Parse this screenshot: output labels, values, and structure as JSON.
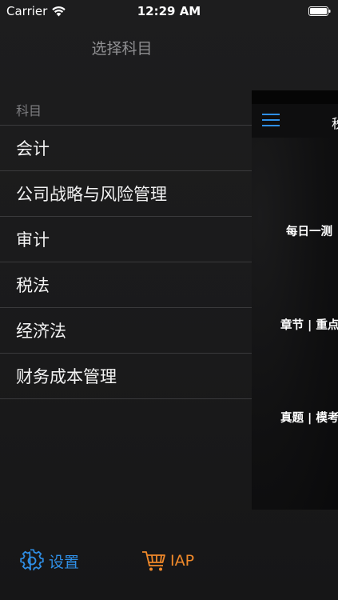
{
  "status_bar": {
    "carrier": "Carrier",
    "time": "12:29 AM"
  },
  "menu": {
    "title": "选择科目",
    "section_header": "科目",
    "subjects": [
      "会计",
      "公司战略与风险管理",
      "审计",
      "税法",
      "经济法",
      "财务成本管理"
    ]
  },
  "bottom": {
    "settings_label": "设置",
    "iap_label": "IAP"
  },
  "main_panel": {
    "nav_title": "税",
    "daily_test": "每日一测",
    "chapter_key": "章节 | 重点",
    "exam_mock": "真题 | 模考"
  },
  "colors": {
    "background": "#1b1b1c",
    "accent_blue": "#2f8fe6",
    "accent_orange": "#f0892a",
    "separator": "#3a3a3c"
  },
  "icons": {
    "wifi": "wifi-icon",
    "battery": "battery-icon",
    "settings": "gear-icon",
    "iap": "cart-icon",
    "menu": "hamburger-icon"
  }
}
